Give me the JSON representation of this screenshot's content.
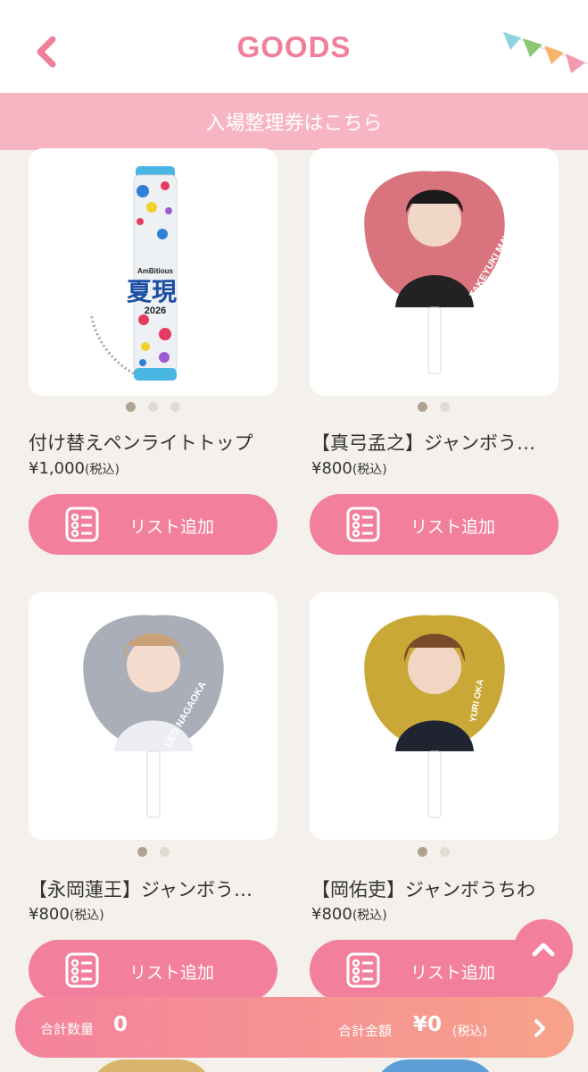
{
  "header": {
    "title": "GOODS",
    "accent_color": "#ef7f9b",
    "bunting_colors": [
      "#8fd3e0",
      "#8cc874",
      "#f6b46a",
      "#f29ab0"
    ]
  },
  "ticket_banner": {
    "label": "入場整理券はこちら"
  },
  "products": [
    {
      "name": "付け替えペンライトトップ",
      "price": "¥1,000",
      "tax": "(税込)",
      "image_icon": "penlight-top-icon",
      "image_text": {
        "brand": "AmBitious",
        "title": "夏現",
        "year": "2026"
      },
      "slides": 3,
      "active_slide": 1,
      "button_label": "リスト追加"
    },
    {
      "name": "【真弓孟之】ジャンボう…",
      "price": "¥800",
      "tax": "(税込)",
      "image_icon": "uchiwa-fan-icon",
      "image_text": {
        "fan_name": "TAKEYUKI MAYUMI"
      },
      "fan_color": "#d9737d",
      "slides": 2,
      "active_slide": 1,
      "button_label": "リスト追加"
    },
    {
      "name": "【永岡蓮王】ジャンボう…",
      "price": "¥800",
      "tax": "(税込)",
      "image_icon": "uchiwa-fan-icon",
      "image_text": {
        "fan_name": "LEO NAGAOKA"
      },
      "fan_color": "#a9aeb8",
      "slides": 2,
      "active_slide": 1,
      "button_label": "リスト追加"
    },
    {
      "name": "【岡佑吏】ジャンボうちわ",
      "price": "¥800",
      "tax": "(税込)",
      "image_icon": "uchiwa-fan-icon",
      "image_text": {
        "fan_name": "YURI OKA"
      },
      "fan_color": "#c9a838",
      "slides": 2,
      "active_slide": 1,
      "button_label": "リスト追加"
    }
  ],
  "footer": {
    "qty_label": "合計数量",
    "qty_value": "0",
    "amount_label": "合計金額",
    "amount_value": "¥0",
    "amount_tax": "(税込)"
  },
  "colors": {
    "button_pink": "#f27f9b",
    "banner_pink": "#f7b5c4",
    "background": "#f4f1ec",
    "dot_active": "#b0a290",
    "dot_inactive": "#e0dbd3"
  }
}
